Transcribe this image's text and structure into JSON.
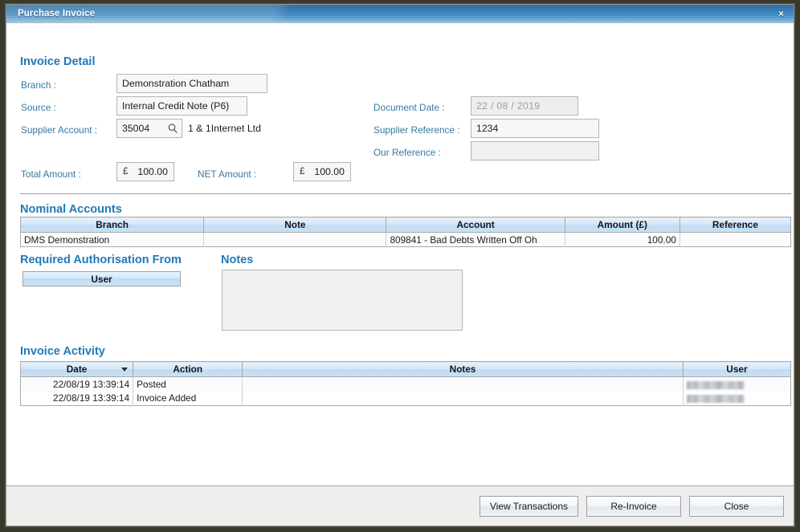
{
  "window": {
    "title": "Purchase Invoice",
    "close_label": "×"
  },
  "invoice_detail": {
    "heading": "Invoice Detail",
    "branch_label": "Branch :",
    "branch_value": "Demonstration Chatham",
    "source_label": "Source :",
    "source_value": "Internal Credit Note (P6)",
    "supplier_account_label": "Supplier Account :",
    "supplier_account_value": "35004",
    "supplier_name": "1 & 1Internet Ltd",
    "document_date_label": "Document Date :",
    "document_date_value": "22  /  08  /  2019",
    "supplier_reference_label": "Supplier Reference :",
    "supplier_reference_value": "1234",
    "our_reference_label": "Our Reference :",
    "our_reference_value": "",
    "total_amount_label": "Total Amount :",
    "total_amount_currency": "£",
    "total_amount_value": "100.00",
    "net_amount_label": "NET Amount :",
    "net_amount_currency": "£",
    "net_amount_value": "100.00"
  },
  "nominal_accounts": {
    "heading": "Nominal Accounts",
    "columns": [
      "Branch",
      "Note",
      "Account",
      "Amount (£)",
      "Reference"
    ],
    "rows": [
      {
        "branch": "DMS Demonstration",
        "note": "",
        "account": "809841 - Bad Debts Written Off Oh",
        "amount": "100.00",
        "reference": ""
      }
    ]
  },
  "required_authorisation": {
    "heading": "Required Authorisation From",
    "column_header": "User"
  },
  "notes": {
    "heading": "Notes",
    "value": "",
    "placeholder": ""
  },
  "invoice_activity": {
    "heading": "Invoice Activity",
    "columns": [
      "Date",
      "Action",
      "Notes",
      "User"
    ],
    "sorted_column": "Date",
    "sort_direction": "descending",
    "rows": [
      {
        "date": "22/08/19 13:39:14",
        "action": "Posted",
        "notes": "",
        "user": ""
      },
      {
        "date": "22/08/19 13:39:14",
        "action": "Invoice Added",
        "notes": "",
        "user": ""
      }
    ]
  },
  "footer": {
    "view_transactions_label": "View Transactions",
    "re_invoice_label": "Re-Invoice",
    "close_label": "Close"
  },
  "colors": {
    "accent_blue": "#1f7ab8",
    "label_blue": "#36799f",
    "titlebar_blue": "#2f7ab5",
    "grid_header_blue": "#c9e2f6"
  }
}
